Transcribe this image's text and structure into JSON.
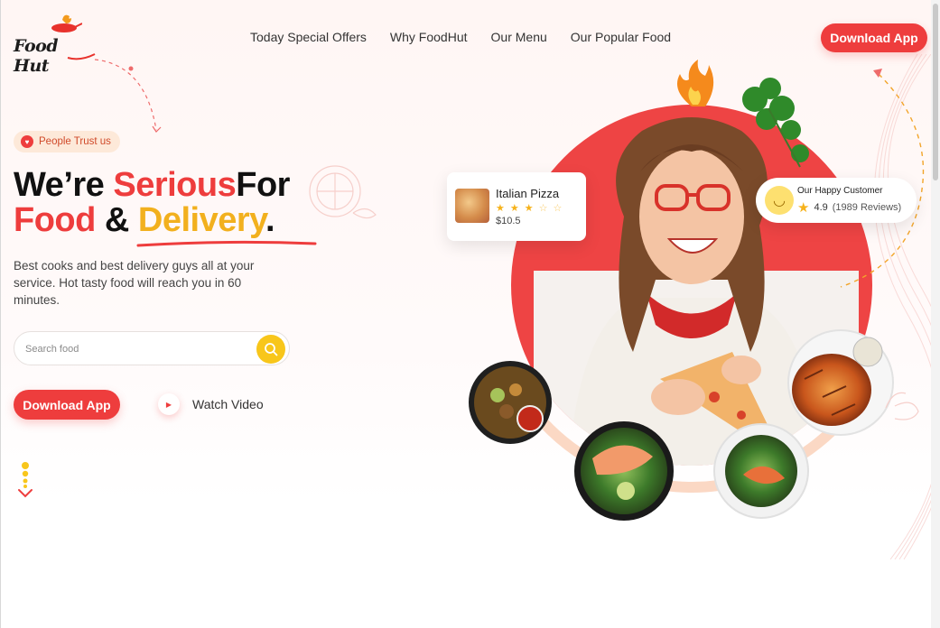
{
  "header": {
    "logo_text": "Food Hut",
    "nav": [
      "Today Special Offers",
      "Why FoodHut",
      "Our Menu",
      "Our Popular Food"
    ],
    "download_label": "Download App"
  },
  "hero": {
    "badge": "People Trust us",
    "headline": {
      "part1": "We’re ",
      "part2": "Serious",
      "part3": "For",
      "part4": "Food",
      "part5": " & ",
      "part6": "Delivery",
      "part7": "."
    },
    "subtext": "Best cooks and best delivery guys all at your service. Hot tasty food will reach you in 60 minutes.",
    "search_placeholder": "Search food",
    "download_label": "Download App",
    "watch_label": "Watch Video"
  },
  "pizza_card": {
    "name": "Italian Pizza",
    "price": "$10.5",
    "rating": 3
  },
  "customer_card": {
    "title": "Our Happy Customer",
    "rating": "4.9",
    "reviews": "(1989 Reviews)"
  },
  "colors": {
    "accent": "#ee3d3d",
    "yellow": "#f2b01e",
    "search_button": "#f8c61b"
  },
  "icons": [
    "logo-icon",
    "heart-icon",
    "search-icon",
    "play-icon",
    "fire-icon",
    "cilantro-icon",
    "star-icon",
    "smile-icon",
    "scroll-down-icon"
  ]
}
